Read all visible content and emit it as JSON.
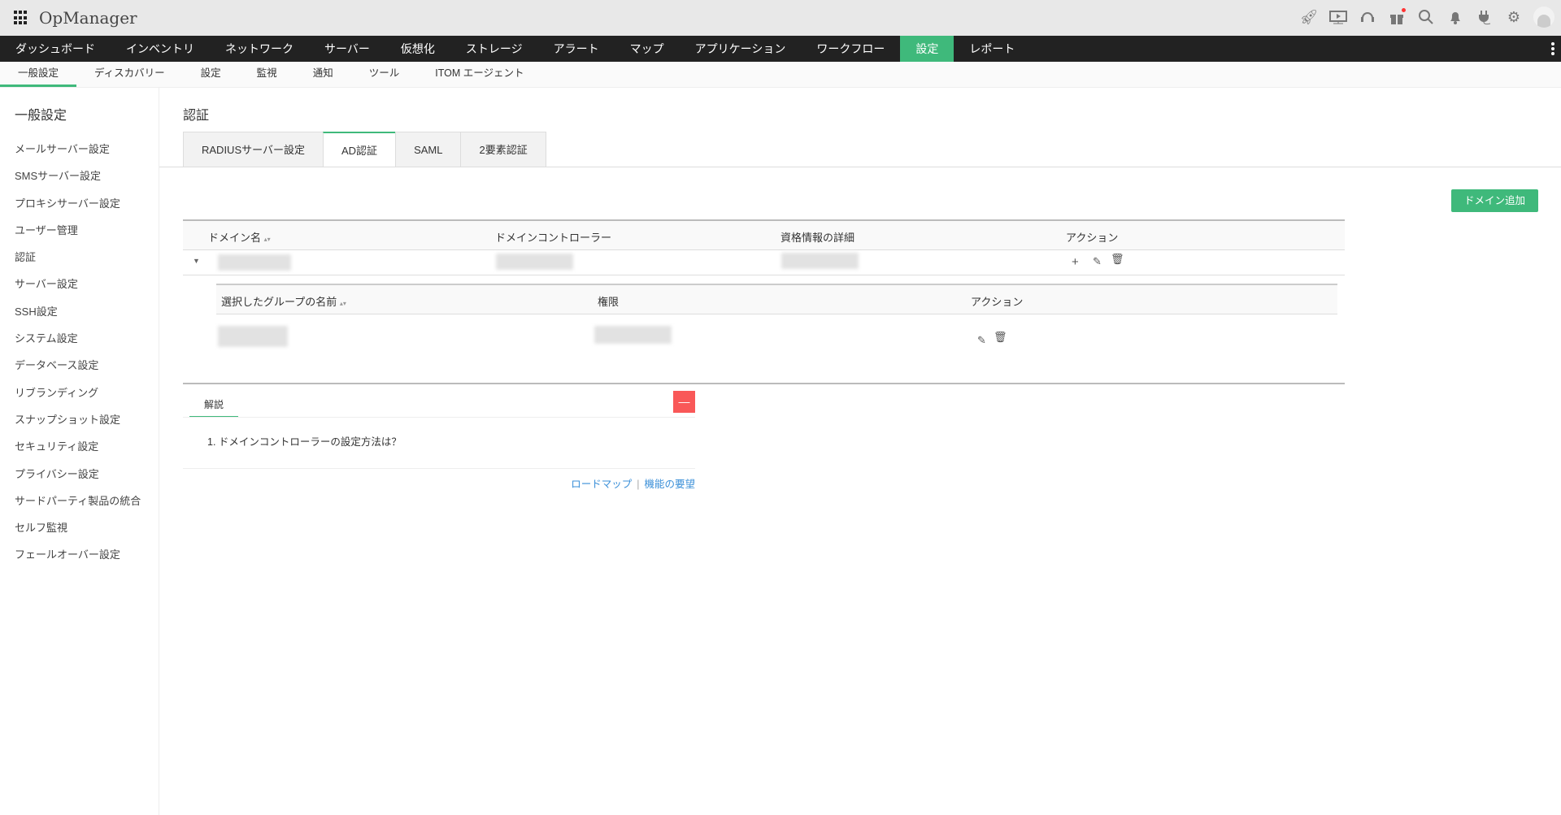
{
  "app": {
    "title": "OpManager"
  },
  "top_icons": [
    "rocket-icon",
    "presentation-icon",
    "headset-icon",
    "gift-icon",
    "search-icon",
    "bell-icon",
    "plug-icon",
    "gear-icon",
    "avatar-icon"
  ],
  "nav": {
    "items": [
      "ダッシュボード",
      "インベントリ",
      "ネットワーク",
      "サーバー",
      "仮想化",
      "ストレージ",
      "アラート",
      "マップ",
      "アプリケーション",
      "ワークフロー",
      "設定",
      "レポート"
    ],
    "active": "設定"
  },
  "subnav": {
    "items": [
      "一般設定",
      "ディスカバリー",
      "設定",
      "監視",
      "通知",
      "ツール",
      "ITOM エージェント"
    ],
    "active": "一般設定"
  },
  "sidebar": {
    "title": "一般設定",
    "items": [
      "メールサーバー設定",
      "SMSサーバー設定",
      "プロキシサーバー設定",
      "ユーザー管理",
      "認証",
      "サーバー設定",
      "SSH設定",
      "システム設定",
      "データベース設定",
      "リブランディング",
      "スナップショット設定",
      "セキュリティ設定",
      "プライバシー設定",
      "サードパーティ製品の統合",
      "セルフ監視",
      "フェールオーバー設定"
    ]
  },
  "page": {
    "title": "認証",
    "tabs": [
      "RADIUSサーバー設定",
      "AD認証",
      "SAML",
      "2要素認証"
    ],
    "active_tab": "AD認証",
    "add_domain": "ドメイン追加"
  },
  "table": {
    "headers": [
      "ドメイン名",
      "ドメインコントローラー",
      "資格情報の詳細",
      "アクション"
    ],
    "sub_headers": [
      "選択したグループの名前",
      "権限",
      "アクション"
    ]
  },
  "help": {
    "tab": "解説",
    "minimize": "—",
    "question": "1. ドメインコントローラーの設定方法は？",
    "links": [
      "ロードマップ",
      "機能の要望"
    ]
  },
  "colors": {
    "accent": "#3fb97b",
    "nav_bg": "#222222",
    "danger": "#f95858",
    "link": "#3a8fd8"
  }
}
